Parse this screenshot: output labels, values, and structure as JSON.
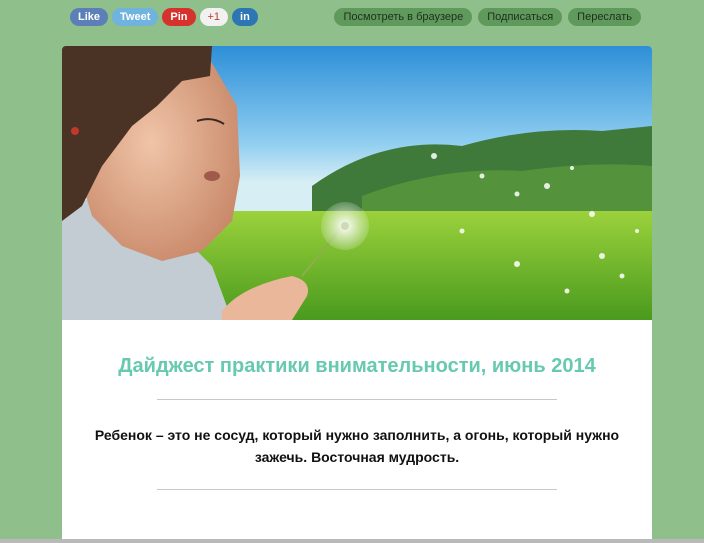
{
  "social": {
    "like": {
      "label": "Like",
      "color": "#5c7fb8"
    },
    "tweet": {
      "label": "Tweet",
      "color": "#6fb3de"
    },
    "pin": {
      "label": "Pin",
      "color": "#d5322e"
    },
    "plus": {
      "label": "+1",
      "color": "#f1f1f1"
    },
    "linkedin": {
      "label": "in",
      "color": "#2c77b3"
    }
  },
  "links": {
    "browser": "Посмотреть в браузере",
    "subscribe": "Подписаться",
    "forward": "Переслать"
  },
  "hero": {
    "icon": "dandelion-image"
  },
  "content": {
    "title": "Дайджест практики внимательности, июнь 2014",
    "quote": "Ребенок – это не сосуд, который нужно заполнить, а огонь, который нужно зажечь. Восточная мудрость."
  },
  "colors": {
    "background": "#8fbf8a",
    "title": "#66c9b0",
    "link_button": "#5f9a5c"
  }
}
